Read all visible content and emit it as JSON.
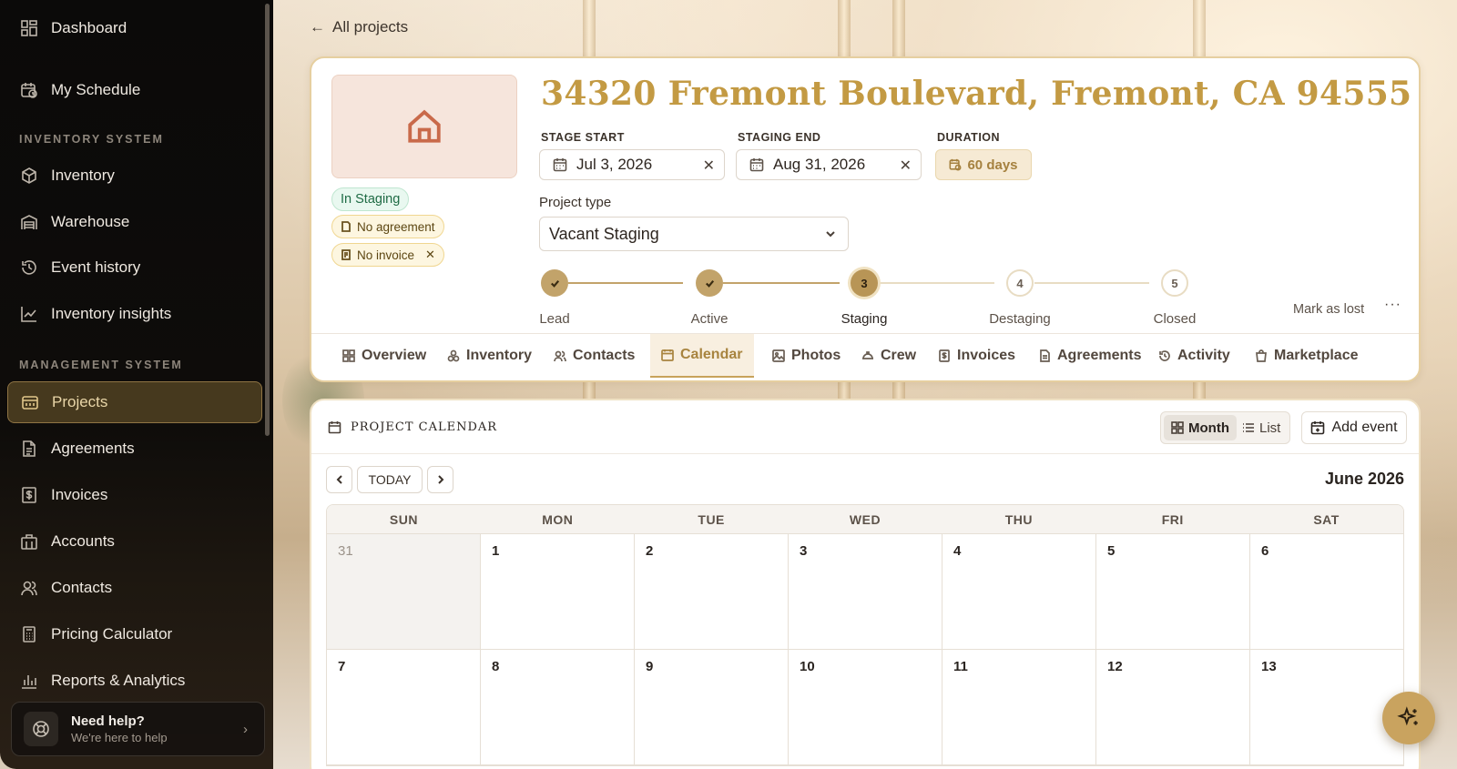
{
  "sidebar": {
    "items": [
      {
        "label": "Dashboard"
      },
      {
        "label": "My Schedule"
      },
      {
        "label": "Inventory"
      },
      {
        "label": "Warehouse"
      },
      {
        "label": "Event history"
      },
      {
        "label": "Inventory insights"
      },
      {
        "label": "Projects"
      },
      {
        "label": "Agreements"
      },
      {
        "label": "Invoices"
      },
      {
        "label": "Accounts"
      },
      {
        "label": "Contacts"
      },
      {
        "label": "Pricing Calculator"
      },
      {
        "label": "Reports & Analytics"
      }
    ],
    "sections": {
      "inventory": "INVENTORY SYSTEM",
      "management": "MANAGEMENT SYSTEM"
    },
    "help": {
      "title": "Need help?",
      "subtitle": "We're here to help"
    }
  },
  "back_link": "All projects",
  "project": {
    "title": "34320 Fremont Boulevard, Fremont, CA 94555",
    "status_badge": "In Staging",
    "agreement_badge": "No agreement",
    "invoice_badge": "No invoice",
    "stage_start_label": "STAGE START",
    "stage_start": "Jul 3, 2026",
    "staging_end_label": "STAGING END",
    "staging_end": "Aug 31, 2026",
    "duration_label": "DURATION",
    "duration": "60 days",
    "project_type_label": "Project type",
    "project_type": "Vacant Staging",
    "steps": [
      {
        "num": "1",
        "label": "Lead",
        "state": "done"
      },
      {
        "num": "2",
        "label": "Active",
        "state": "done"
      },
      {
        "num": "3",
        "label": "Staging",
        "state": "current"
      },
      {
        "num": "4",
        "label": "Destaging",
        "state": "todo"
      },
      {
        "num": "5",
        "label": "Closed",
        "state": "todo"
      }
    ],
    "mark_lost": "Mark as lost",
    "more": "···"
  },
  "tabs": [
    {
      "label": "Overview"
    },
    {
      "label": "Inventory"
    },
    {
      "label": "Contacts"
    },
    {
      "label": "Calendar"
    },
    {
      "label": "Photos"
    },
    {
      "label": "Crew"
    },
    {
      "label": "Invoices"
    },
    {
      "label": "Agreements"
    },
    {
      "label": "Activity"
    },
    {
      "label": "Marketplace"
    }
  ],
  "calendar": {
    "title": "PROJECT CALENDAR",
    "view_month": "Month",
    "view_list": "List",
    "add_event": "Add event",
    "today": "TODAY",
    "month": "June 2026",
    "weekdays": [
      "SUN",
      "MON",
      "TUE",
      "WED",
      "THU",
      "FRI",
      "SAT"
    ],
    "week1": [
      "31",
      "1",
      "2",
      "3",
      "4",
      "5",
      "6"
    ],
    "week2": [
      "7",
      "8",
      "9",
      "10",
      "11",
      "12",
      "13"
    ]
  },
  "colors": {
    "accent": "#c39a43",
    "sidebar_bg": "#0b0a09",
    "active_nav": "#5a4826"
  }
}
